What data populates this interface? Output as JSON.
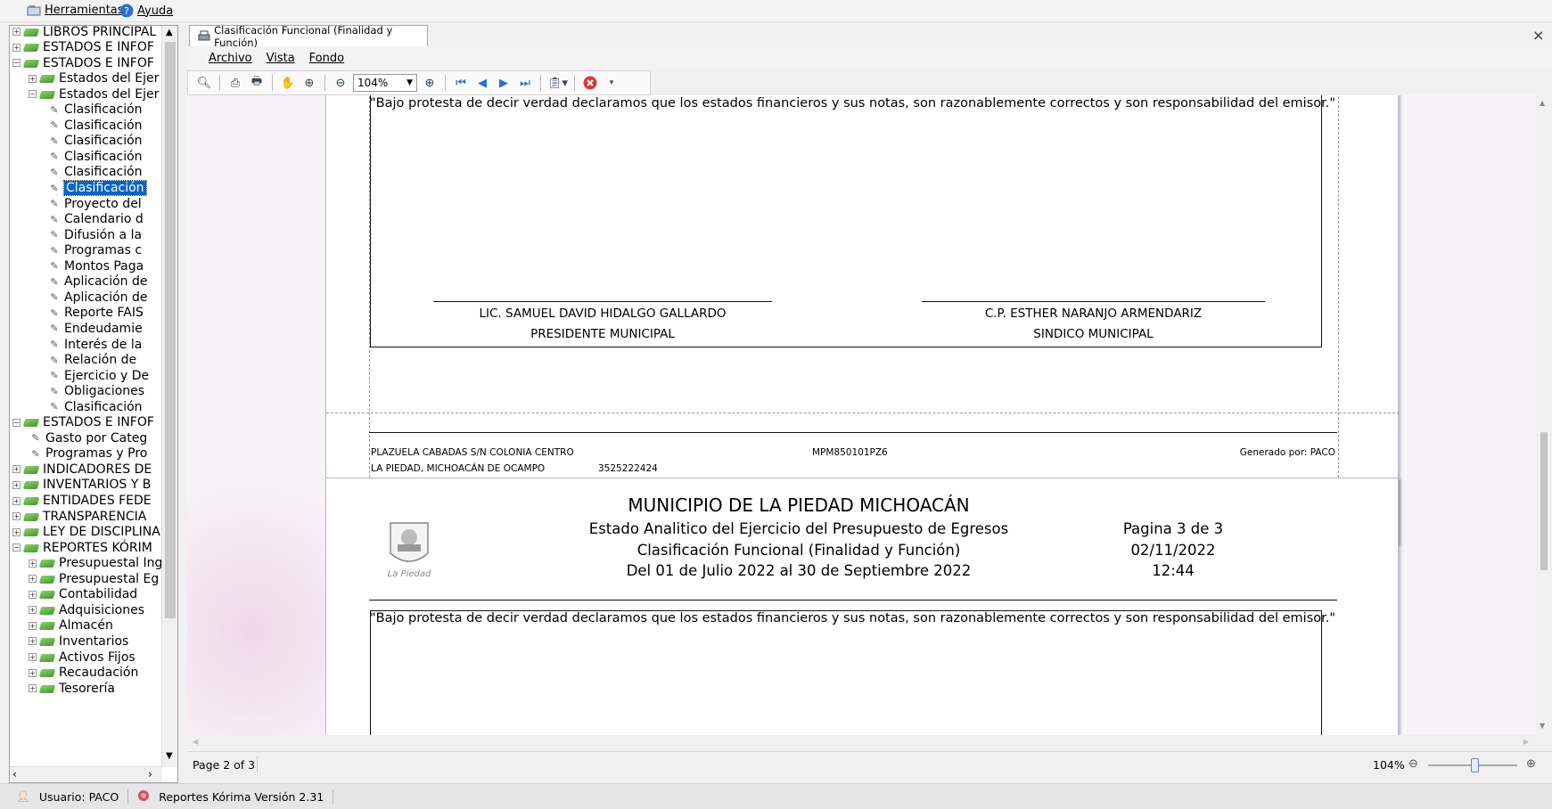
{
  "menubar": {
    "herramientas": "Herramientas",
    "ayuda": "Ayuda"
  },
  "tree": {
    "items": [
      {
        "label": "LIBROS PRINCIPAL",
        "level": 0,
        "type": "book",
        "exp": "+"
      },
      {
        "label": "ESTADOS E INFOF",
        "level": 0,
        "type": "book",
        "exp": "+"
      },
      {
        "label": "ESTADOS E INFOF",
        "level": 0,
        "type": "book",
        "exp": "-"
      },
      {
        "label": "Estados del Ejer",
        "level": 1,
        "type": "book",
        "exp": "+"
      },
      {
        "label": "Estados del Ejer",
        "level": 1,
        "type": "book",
        "exp": "-"
      },
      {
        "label": "Clasificación",
        "level": 2,
        "type": "report"
      },
      {
        "label": "Clasificación",
        "level": 2,
        "type": "report"
      },
      {
        "label": "Clasificación",
        "level": 2,
        "type": "report"
      },
      {
        "label": "Clasificación",
        "level": 2,
        "type": "report"
      },
      {
        "label": "Clasificación",
        "level": 2,
        "type": "report"
      },
      {
        "label": "Clasificación",
        "level": 2,
        "type": "report",
        "selected": true
      },
      {
        "label": "Proyecto del",
        "level": 2,
        "type": "report"
      },
      {
        "label": "Calendario d",
        "level": 2,
        "type": "report"
      },
      {
        "label": "Difusión a la",
        "level": 2,
        "type": "report"
      },
      {
        "label": "Programas c",
        "level": 2,
        "type": "report"
      },
      {
        "label": "Montos Paga",
        "level": 2,
        "type": "report"
      },
      {
        "label": "Aplicación de",
        "level": 2,
        "type": "report"
      },
      {
        "label": "Aplicación de",
        "level": 2,
        "type": "report"
      },
      {
        "label": "Reporte FAIS",
        "level": 2,
        "type": "report"
      },
      {
        "label": "Endeudamie",
        "level": 2,
        "type": "report"
      },
      {
        "label": "Interés de la",
        "level": 2,
        "type": "report"
      },
      {
        "label": "Relación de",
        "level": 2,
        "type": "report"
      },
      {
        "label": "Ejercicio y De",
        "level": 2,
        "type": "report"
      },
      {
        "label": "Obligaciones",
        "level": 2,
        "type": "report"
      },
      {
        "label": "Clasificación",
        "level": 2,
        "type": "report"
      },
      {
        "label": "ESTADOS E INFOF",
        "level": 0,
        "type": "book",
        "exp": "-"
      },
      {
        "label": "Gasto por Categ",
        "level": 1,
        "type": "report"
      },
      {
        "label": "Programas y Pro",
        "level": 1,
        "type": "report"
      },
      {
        "label": "INDICADORES DE",
        "level": 0,
        "type": "book",
        "exp": "+"
      },
      {
        "label": "INVENTARIOS Y B",
        "level": 0,
        "type": "book",
        "exp": "+"
      },
      {
        "label": "ENTIDADES FEDE",
        "level": 0,
        "type": "book",
        "exp": "+"
      },
      {
        "label": "TRANSPARENCIA",
        "level": 0,
        "type": "book",
        "exp": "+"
      },
      {
        "label": "LEY DE DISCIPLINA",
        "level": 0,
        "type": "book",
        "exp": "+"
      },
      {
        "label": "REPORTES KÓRIM",
        "level": 0,
        "type": "book",
        "exp": "-"
      },
      {
        "label": "Presupuestal Ing",
        "level": 1,
        "type": "book",
        "exp": "+"
      },
      {
        "label": "Presupuestal Eg",
        "level": 1,
        "type": "book",
        "exp": "+"
      },
      {
        "label": "Contabilidad",
        "level": 1,
        "type": "book",
        "exp": "+"
      },
      {
        "label": "Adquisiciones",
        "level": 1,
        "type": "book",
        "exp": "+"
      },
      {
        "label": "Almacén",
        "level": 1,
        "type": "book",
        "exp": "+"
      },
      {
        "label": "Inventarios",
        "level": 1,
        "type": "book",
        "exp": "+"
      },
      {
        "label": "Activos Fijos",
        "level": 1,
        "type": "book",
        "exp": "+"
      },
      {
        "label": "Recaudación",
        "level": 1,
        "type": "book",
        "exp": "+"
      },
      {
        "label": "Tesorería",
        "level": 1,
        "type": "book",
        "exp": "+"
      }
    ]
  },
  "tab": {
    "label": "Clasificación Funcional (Finalidad y Función)"
  },
  "docmenu": {
    "archivo": "Archivo",
    "vista": "Vista",
    "fondo": "Fondo"
  },
  "toolbar": {
    "zoom": "104%"
  },
  "page2": {
    "disclaimer": "\"Bajo protesta de decir verdad declaramos que los estados financieros y sus notas, son razonablemente correctos y son responsabilidad del emisor.\"",
    "sig1_name": "LIC. SAMUEL DAVID HIDALGO GALLARDO",
    "sig1_title": "PRESIDENTE MUNICIPAL",
    "sig2_name": "C.P. ESTHER NARANJO ARMENDARIZ",
    "sig2_title": "SINDICO MUNICIPAL",
    "addr1": "PLAZUELA CABADAS S/N COLONIA CENTRO",
    "addr2": "LA PIEDAD, MICHOACÁN DE OCAMPO",
    "phone": "3525222424",
    "rfc": "MPM850101PZ6",
    "generated": "Generado por: PACO"
  },
  "page3": {
    "title": "MUNICIPIO DE LA PIEDAD MICHOACÁN",
    "subtitle1": "Estado Analitico del Ejercicio del Presupuesto de Egresos",
    "subtitle2": "Clasificación Funcional (Finalidad y Función)",
    "period": "Del 01 de Julio 2022 al 30 de Septiembre 2022",
    "page": "Pagina 3 de 3",
    "date": "02/11/2022",
    "time": "12:44",
    "logo_text": "La Piedad",
    "disclaimer": "\"Bajo protesta de decir verdad declaramos que los estados financieros y sus notas, son razonablemente correctos y son responsabilidad del emisor.\""
  },
  "status": {
    "page": "Page 2 of 3",
    "zoom": "104%",
    "user": "Usuario: PACO",
    "version": "Reportes Kórima Versión 2.31"
  }
}
